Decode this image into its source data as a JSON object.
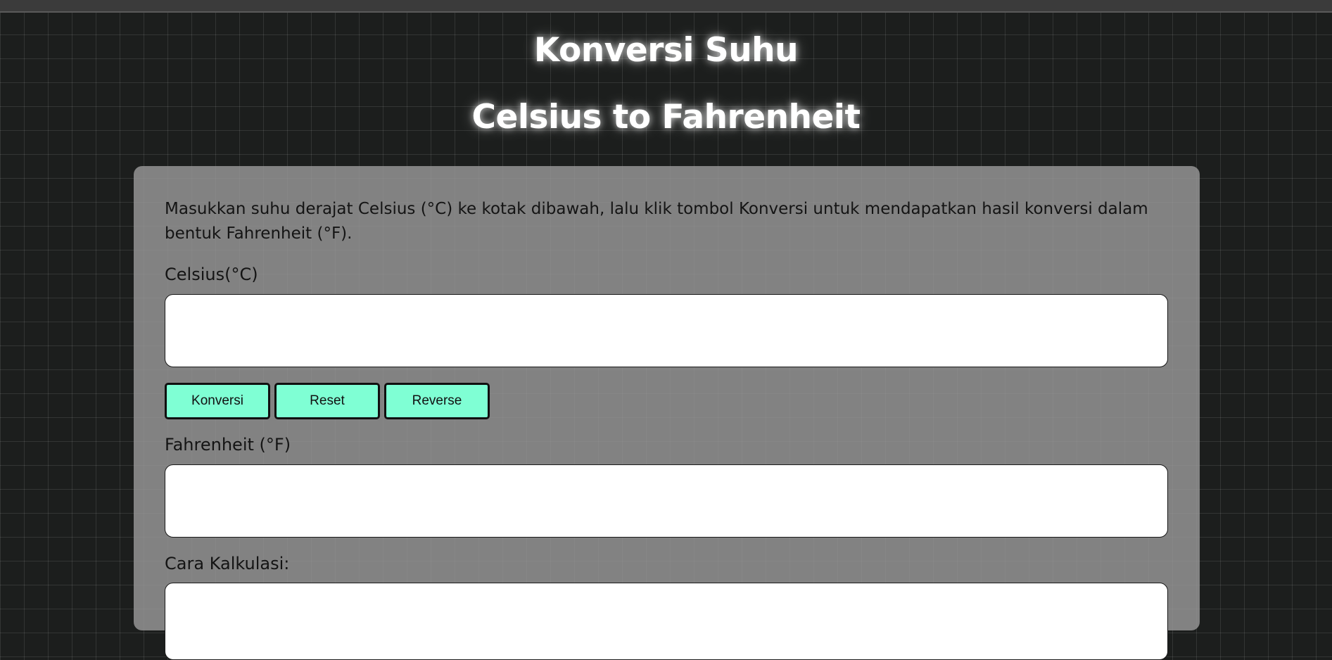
{
  "page": {
    "title": "Konversi Suhu",
    "subtitle": "Celsius to Fahrenheit"
  },
  "card": {
    "description": "Masukkan suhu derajat Celsius (°C) ke kotak dibawah, lalu klik tombol Konversi untuk mendapatkan hasil konversi dalam bentuk Fahrenheit (°F).",
    "celsius_label": "Celsius(°C)",
    "celsius_value": "",
    "fahrenheit_label": "Fahrenheit (°F)",
    "fahrenheit_value": "",
    "calculation_label": "Cara Kalkulasi:",
    "calculation_value": "",
    "buttons": {
      "convert": "Konversi",
      "reset": "Reset",
      "reverse": "Reverse"
    }
  },
  "colors": {
    "background": "#1c1e1d",
    "card": "#989898",
    "button": "#7fffd4",
    "heading_text": "#ffffff"
  }
}
